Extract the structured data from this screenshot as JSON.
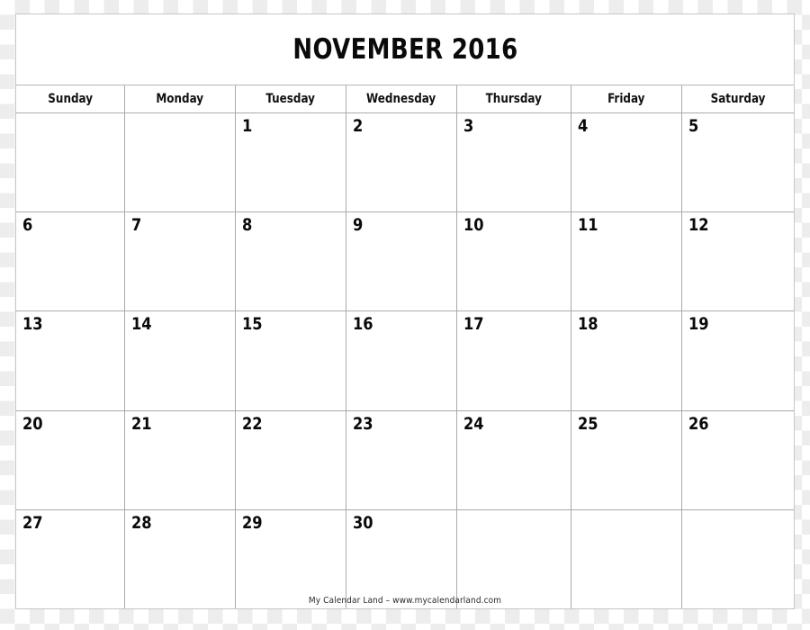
{
  "calendar": {
    "title": "NOVEMBER 2016",
    "month_name": "November",
    "year": "2016",
    "weekday_headers": [
      "Sunday",
      "Monday",
      "Tuesday",
      "Wednesday",
      "Thursday",
      "Friday",
      "Saturday"
    ],
    "weeks": [
      [
        "",
        "",
        "1",
        "2",
        "3",
        "4",
        "5"
      ],
      [
        "6",
        "7",
        "8",
        "9",
        "10",
        "11",
        "12"
      ],
      [
        "13",
        "14",
        "15",
        "16",
        "17",
        "18",
        "19"
      ],
      [
        "20",
        "21",
        "22",
        "23",
        "24",
        "25",
        "26"
      ],
      [
        "27",
        "28",
        "29",
        "30",
        "",
        "",
        ""
      ]
    ],
    "footer_credit": "My Calendar Land – www.mycalendarland.com",
    "colors": {
      "page_background": "#ffffff",
      "grid_line": "#aaaaaa",
      "outer_border": "#c6c6c6",
      "title_text": "#0a0a0a",
      "day_number_text": "#0a0a0a",
      "weekday_text": "#111111",
      "footer_text": "#2b2b2b",
      "checker_light": "#ededed"
    }
  }
}
